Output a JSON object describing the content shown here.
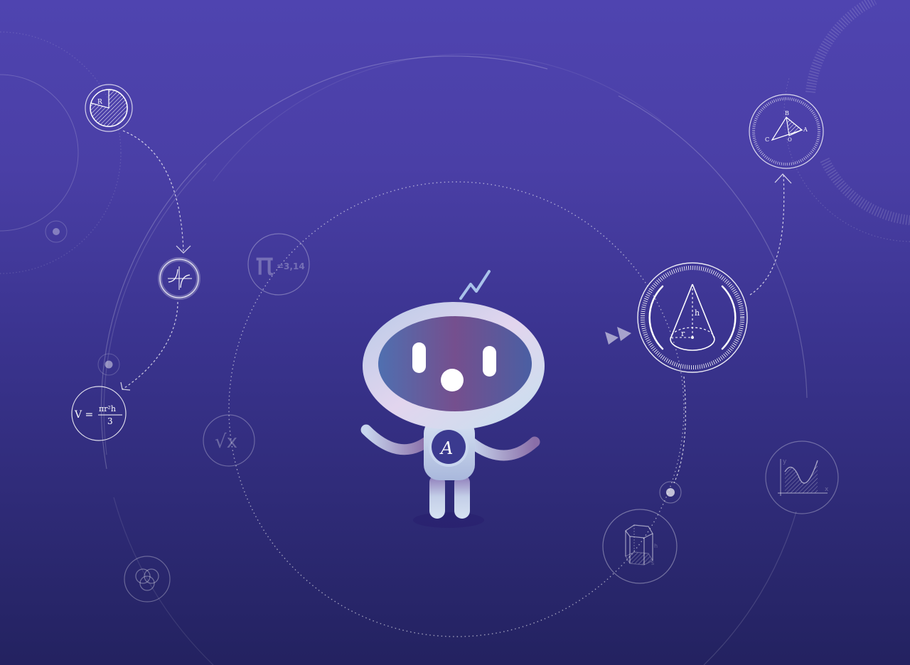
{
  "symbols": {
    "pi": "π",
    "pi_value": "=3,14",
    "sqrt": "√x",
    "formula_lhs": "V =",
    "formula_num": "πr²h",
    "formula_den": "3",
    "sector_label": "R",
    "cone_height": "h",
    "cone_radius": "r",
    "triangle_b": "B",
    "triangle_a": "A",
    "triangle_c": "C",
    "triangle_o": "O",
    "graph_y": "y",
    "graph_x": "x",
    "prism_s": "s",
    "prism_h": "h",
    "robot_logo": "A"
  },
  "colors": {
    "bg_top": "#4f44b0",
    "bg_bottom": "#232260",
    "robot_visor": "#6b4f9a",
    "robot_body": "#c9d8ea"
  },
  "icons": [
    "pie-sector-icon",
    "hyperbola-icon",
    "volume-formula-icon",
    "venn-icon",
    "pi-icon",
    "sqrt-icon",
    "cone-icon",
    "triangle-icon",
    "area-under-curve-icon",
    "prism-icon"
  ]
}
